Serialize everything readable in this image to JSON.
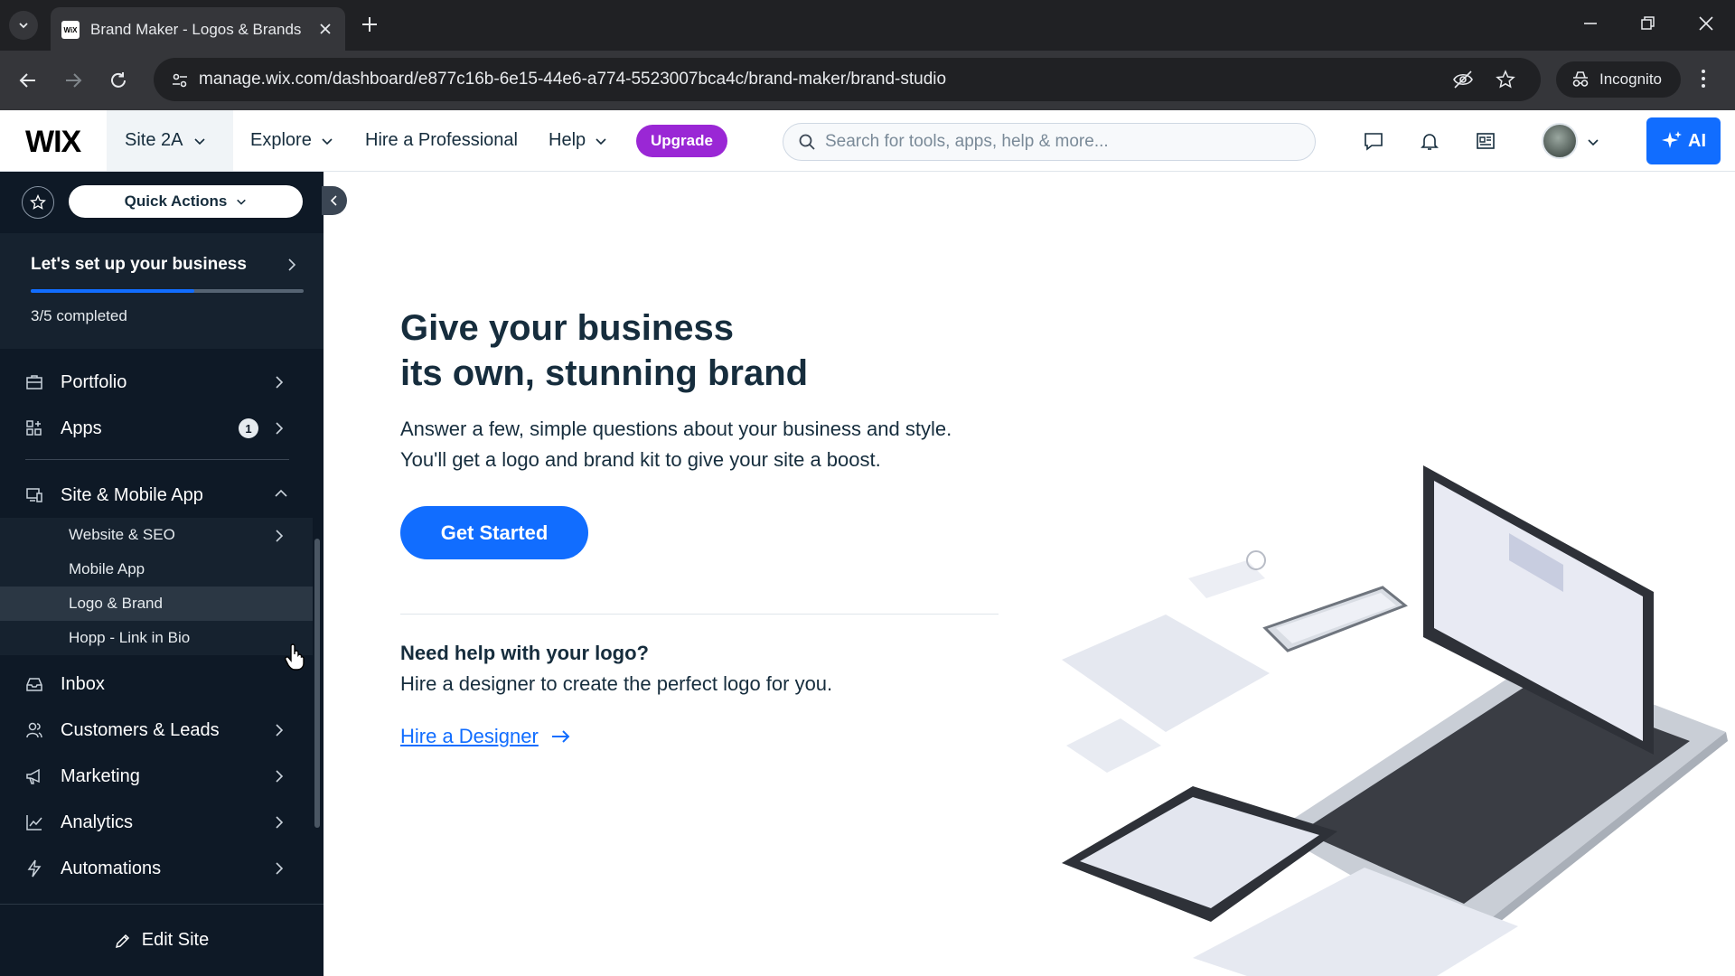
{
  "browser": {
    "tab_title": "Brand Maker - Logos & Brands",
    "favicon_text": "WiX",
    "url": "manage.wix.com/dashboard/e877c16b-6e15-44e6-a774-5523007bca4c/brand-maker/brand-studio",
    "incognito_label": "Incognito"
  },
  "topbar": {
    "logo": "WIX",
    "site_name": "Site 2A",
    "nav": [
      "Explore",
      "Hire a Professional",
      "Help"
    ],
    "upgrade_label": "Upgrade",
    "search_placeholder": "Search for tools, apps, help & more...",
    "ai_label": "AI"
  },
  "sidebar": {
    "quick_actions": "Quick Actions",
    "setup": {
      "title": "Let's set up your business",
      "completed": 3,
      "total": 5,
      "progress_text": "3/5 completed"
    },
    "items": [
      {
        "label": "Portfolio",
        "icon": "portfolio-icon"
      },
      {
        "label": "Apps",
        "icon": "apps-icon",
        "badge": "1"
      },
      {
        "label": "Site & Mobile App",
        "icon": "site-icon",
        "expanded": true
      }
    ],
    "sub_items": [
      {
        "label": "Website & SEO"
      },
      {
        "label": "Mobile App"
      },
      {
        "label": "Logo & Brand",
        "selected": true
      },
      {
        "label": "Hopp - Link in Bio"
      }
    ],
    "items_after": [
      {
        "label": "Inbox",
        "icon": "inbox-icon"
      },
      {
        "label": "Customers & Leads",
        "icon": "customers-icon"
      },
      {
        "label": "Marketing",
        "icon": "marketing-icon"
      },
      {
        "label": "Analytics",
        "icon": "analytics-icon"
      },
      {
        "label": "Automations",
        "icon": "automations-icon"
      }
    ],
    "edit_site": "Edit Site"
  },
  "main": {
    "headline_line1": "Give your business",
    "headline_line2": "its own, stunning brand",
    "desc_line1": "Answer a few, simple questions about your business and style.",
    "desc_line2": "You'll get a logo and brand kit to give your site a boost.",
    "cta_label": "Get Started",
    "help_title": "Need help with your logo?",
    "help_text": "Hire a designer to create the perfect logo for you.",
    "hire_link": "Hire a Designer"
  },
  "colors": {
    "accent": "#116dff",
    "upgrade": "#9a27d5",
    "sidebar_bg": "#0e1926",
    "text": "#162d3d"
  }
}
